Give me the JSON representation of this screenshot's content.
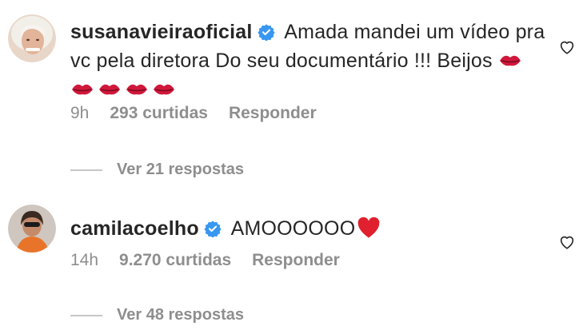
{
  "comments": [
    {
      "username": "susanavieiraoficial",
      "text": "Amada mandei um vídeo pra vc pela diretora Do seu documentário !!! Beijos",
      "emoji": "kiss-mark-emoji x5",
      "time": "9h",
      "likes": "293 curtidas",
      "reply_label": "Responder",
      "view_replies": "Ver 21 respostas"
    },
    {
      "username": "camilacoelho",
      "text": "AMOOOOOO",
      "emoji": "red-heart-emoji",
      "time": "14h",
      "likes": "9.270 curtidas",
      "reply_label": "Responder",
      "view_replies": "Ver 48 respostas"
    }
  ],
  "colors": {
    "text": "#262626",
    "secondary": "#8e8e8e",
    "verified": "#3897f0",
    "heart": "#e0202e",
    "lips": "#d0183b"
  },
  "icons": {
    "verified": "verified-badge-icon",
    "like": "heart-outline-icon"
  }
}
